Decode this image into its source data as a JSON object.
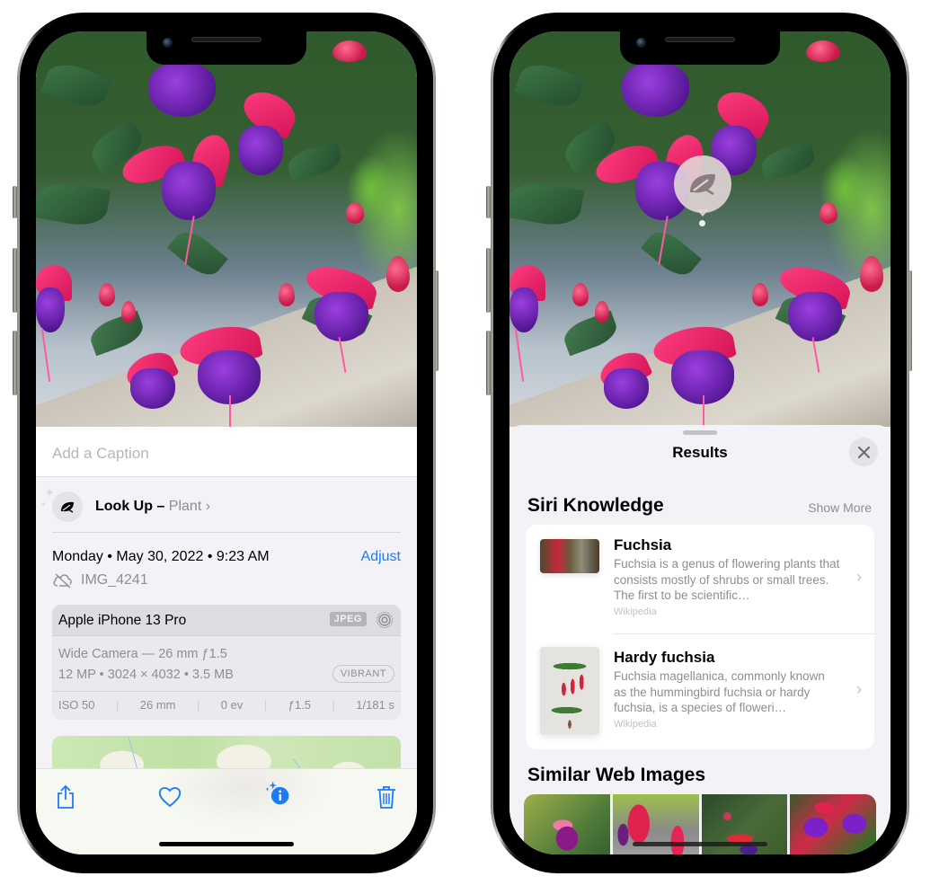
{
  "left_phone": {
    "caption": {
      "placeholder": "Add a Caption"
    },
    "look_up": {
      "label": "Look Up –",
      "subject": "Plant",
      "chevron": "›",
      "icon": "leaf-icon"
    },
    "date_time": "Monday • May 30, 2022 • 9:23 AM",
    "adjust_label": "Adjust",
    "filename": "IMG_4241",
    "file_icon": "cloud-slash-icon",
    "exif": {
      "device": "Apple iPhone 13 Pro",
      "format_badge": "JPEG",
      "live_icon": "live-photo-icon",
      "lens": "Wide Camera — 26 mm ƒ1.5",
      "specs": "12 MP  •  3024 × 4032  •  3.5 MB",
      "style_badge": "VIBRANT",
      "stats": [
        "ISO 50",
        "26 mm",
        "0 ev",
        "ƒ1.5",
        "1/181 s"
      ]
    },
    "toolbar": [
      {
        "name": "share",
        "icon": "share-icon"
      },
      {
        "name": "favorite",
        "icon": "heart-icon"
      },
      {
        "name": "info",
        "icon": "info-sparkle-icon"
      },
      {
        "name": "delete",
        "icon": "trash-icon"
      }
    ]
  },
  "right_phone": {
    "visual_lookup_icon": "leaf-icon",
    "sheet": {
      "title": "Results",
      "close_icon": "close-icon",
      "siri_knowledge": {
        "heading": "Siri Knowledge",
        "show_more": "Show More",
        "items": [
          {
            "title": "Fuchsia",
            "description": "Fuchsia is a genus of flowering plants that consists mostly of shrubs or small trees. The first to be scientific…",
            "source": "Wikipedia"
          },
          {
            "title": "Hardy fuchsia",
            "description": "Fuchsia magellanica, commonly known as the hummingbird fuchsia or hardy fuchsia, is a species of floweri…",
            "source": "Wikipedia"
          }
        ]
      },
      "similar_web_images": {
        "heading": "Similar Web Images",
        "count": 4
      }
    }
  },
  "colors": {
    "accent_blue": "#1a7cf5",
    "secondary_text": "#8e8e93",
    "grouped_background": "#f2f2f7"
  }
}
